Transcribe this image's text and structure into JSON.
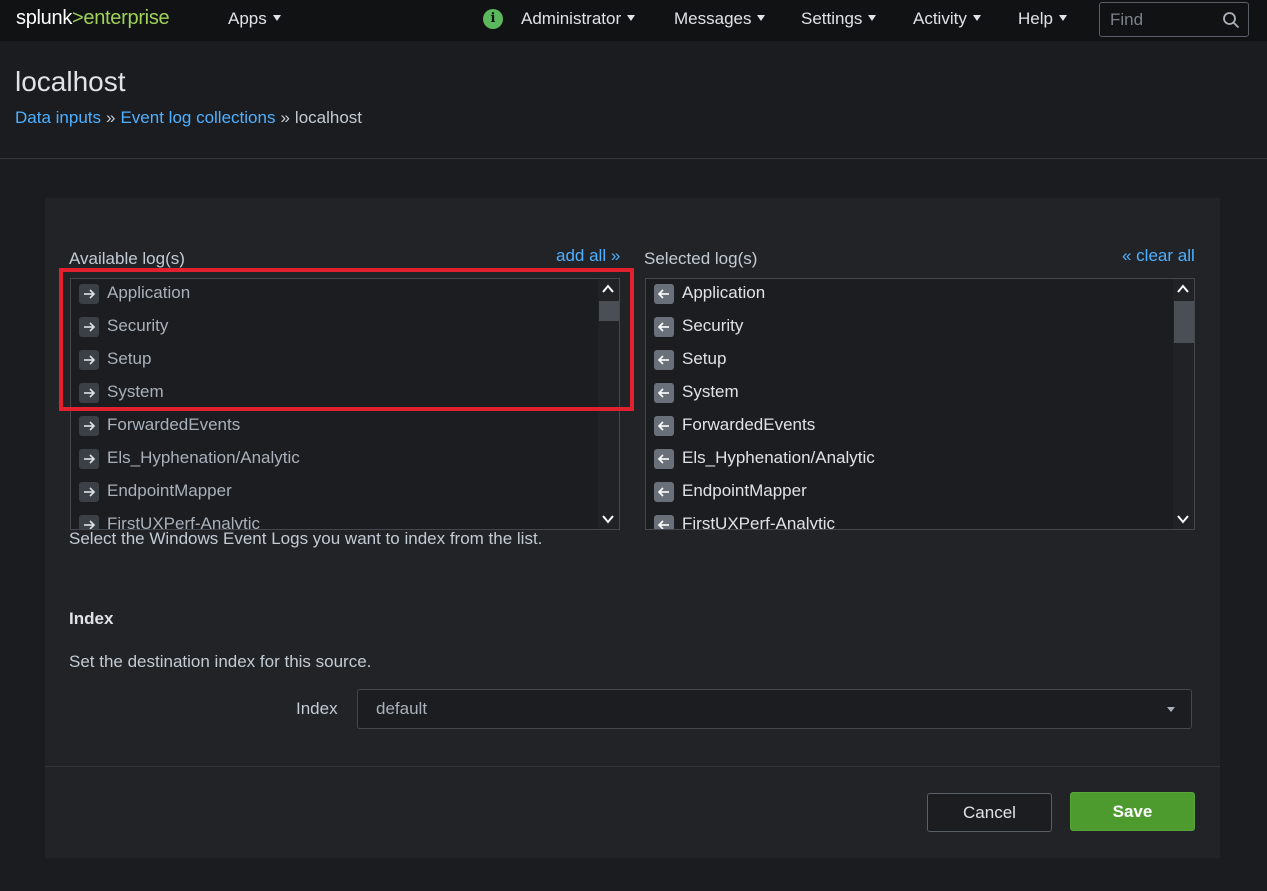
{
  "topbar": {
    "logo_brand": "splunk",
    "logo_gt": ">",
    "logo_product": "enterprise",
    "nav": {
      "apps": "Apps",
      "administrator": "Administrator",
      "messages": "Messages",
      "settings": "Settings",
      "activity": "Activity",
      "help": "Help"
    },
    "info_icon_glyph": "i",
    "search_placeholder": "Find"
  },
  "header": {
    "title": "localhost",
    "breadcrumb": {
      "crumb1": "Data inputs",
      "sep1": "»",
      "crumb2": "Event log collections",
      "sep2": "»",
      "current": "localhost"
    }
  },
  "available": {
    "label": "Available log(s)",
    "add_all": "add all »",
    "items": [
      "Application",
      "Security",
      "Setup",
      "System",
      "ForwardedEvents",
      "Els_Hyphenation/Analytic",
      "EndpointMapper",
      "FirstUXPerf-Analytic"
    ]
  },
  "selected": {
    "label": "Selected log(s)",
    "clear_all": "« clear all",
    "items": [
      "Application",
      "Security",
      "Setup",
      "System",
      "ForwardedEvents",
      "Els_Hyphenation/Analytic",
      "EndpointMapper",
      "FirstUXPerf-Analytic"
    ]
  },
  "help_text": "Select the Windows Event Logs you want to index from the list.",
  "index": {
    "heading": "Index",
    "description": "Set the destination index for this source.",
    "field_label": "Index",
    "value": "default"
  },
  "buttons": {
    "cancel": "Cancel",
    "save": "Save"
  },
  "colors": {
    "accent_link": "#4fb0ff",
    "save_green": "#4d9b2f",
    "highlight_red": "#e3202e",
    "logo_green": "#9fd15b"
  },
  "icons": {
    "available_item": "arrow-right-icon",
    "selected_item": "arrow-left-icon"
  }
}
